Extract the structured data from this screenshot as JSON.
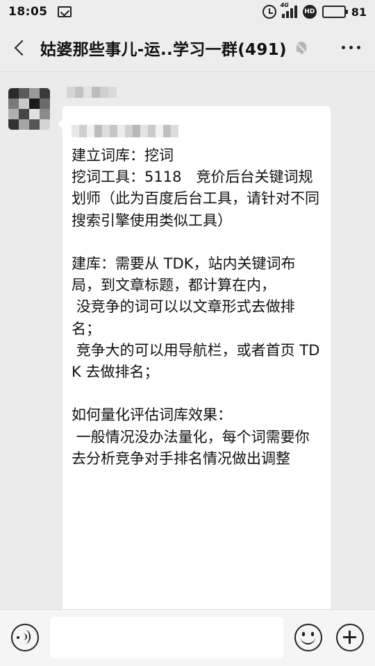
{
  "status_bar": {
    "time": "18:05",
    "network_label": "4G",
    "hd_label": "HD",
    "battery_level": 81,
    "battery_text": "81",
    "icons": [
      "message-icon",
      "alarm-icon",
      "signal-icon",
      "hd-icon",
      "battery-icon"
    ]
  },
  "header": {
    "back_icon": "chevron-left-icon",
    "title": "姑婆那些事儿-运..学习一群(491)",
    "muted": true,
    "mute_icon": "bell-off-icon",
    "more_icon": "more-dots-icon"
  },
  "message": {
    "sender_name_obscured": true,
    "avatar_obscured": true,
    "first_line_obscured": true,
    "body": "建立词库：挖词\n挖词工具：5118　竞价后台关键词规划师（此为百度后台工具，请针对不同搜索引擎使用类似工具）\n\n建库：需要从 TDK，站内关键词布局，到文章标题，都计算在内，\n 没竞争的词可以以文章形式去做排名；\n 竞争大的可以用导航栏，或者首页 TDK 去做排名；\n\n如何量化评估词库效果：\n 一般情况没办法量化，每个词需要你去分析竞争对手排名情况做出调整"
  },
  "input_bar": {
    "voice_icon": "voice-icon",
    "input_value": "",
    "emoji_icon": "emoji-icon",
    "plus_icon": "plus-icon"
  },
  "colors": {
    "background": "#ebebeb",
    "bar_background": "#ededed",
    "bubble": "#ffffff",
    "text": "#111111",
    "muted_icon": "#b5b5b5"
  }
}
